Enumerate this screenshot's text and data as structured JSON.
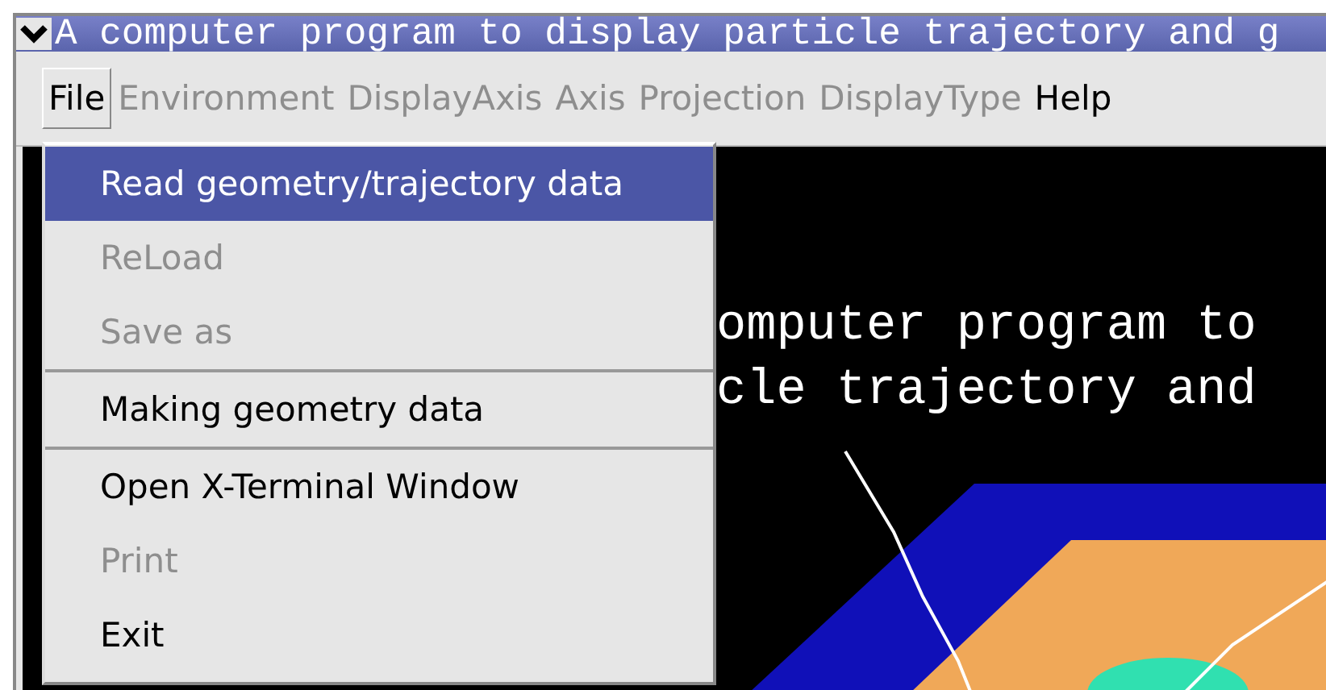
{
  "window": {
    "title": "A computer program to display particle trajectory and g"
  },
  "menu_bar": [
    {
      "label": "File",
      "disabled": false,
      "selected": true
    },
    {
      "label": "Environment",
      "disabled": true,
      "selected": false
    },
    {
      "label": "DisplayAxis",
      "disabled": true,
      "selected": false
    },
    {
      "label": "Axis",
      "disabled": true,
      "selected": false
    },
    {
      "label": "Projection",
      "disabled": true,
      "selected": false
    },
    {
      "label": "DisplayType",
      "disabled": true,
      "selected": false
    },
    {
      "label": "Help",
      "disabled": false,
      "selected": false
    }
  ],
  "file_menu": [
    {
      "label": "Read geometry/trajectory data",
      "disabled": false,
      "selected": true,
      "separator_after": false
    },
    {
      "label": "ReLoad",
      "disabled": true,
      "selected": false,
      "separator_after": false
    },
    {
      "label": "Save as",
      "disabled": true,
      "selected": false,
      "separator_after": true
    },
    {
      "label": "Making geometry data",
      "disabled": false,
      "selected": false,
      "separator_after": true
    },
    {
      "label": "Open X-Terminal Window",
      "disabled": false,
      "selected": false,
      "separator_after": false
    },
    {
      "label": "Print",
      "disabled": true,
      "selected": false,
      "separator_after": false
    },
    {
      "label": "Exit",
      "disabled": false,
      "selected": false,
      "separator_after": false
    }
  ],
  "canvas": {
    "text_lines": [
      "omputer program to",
      "cle trajectory and"
    ]
  }
}
